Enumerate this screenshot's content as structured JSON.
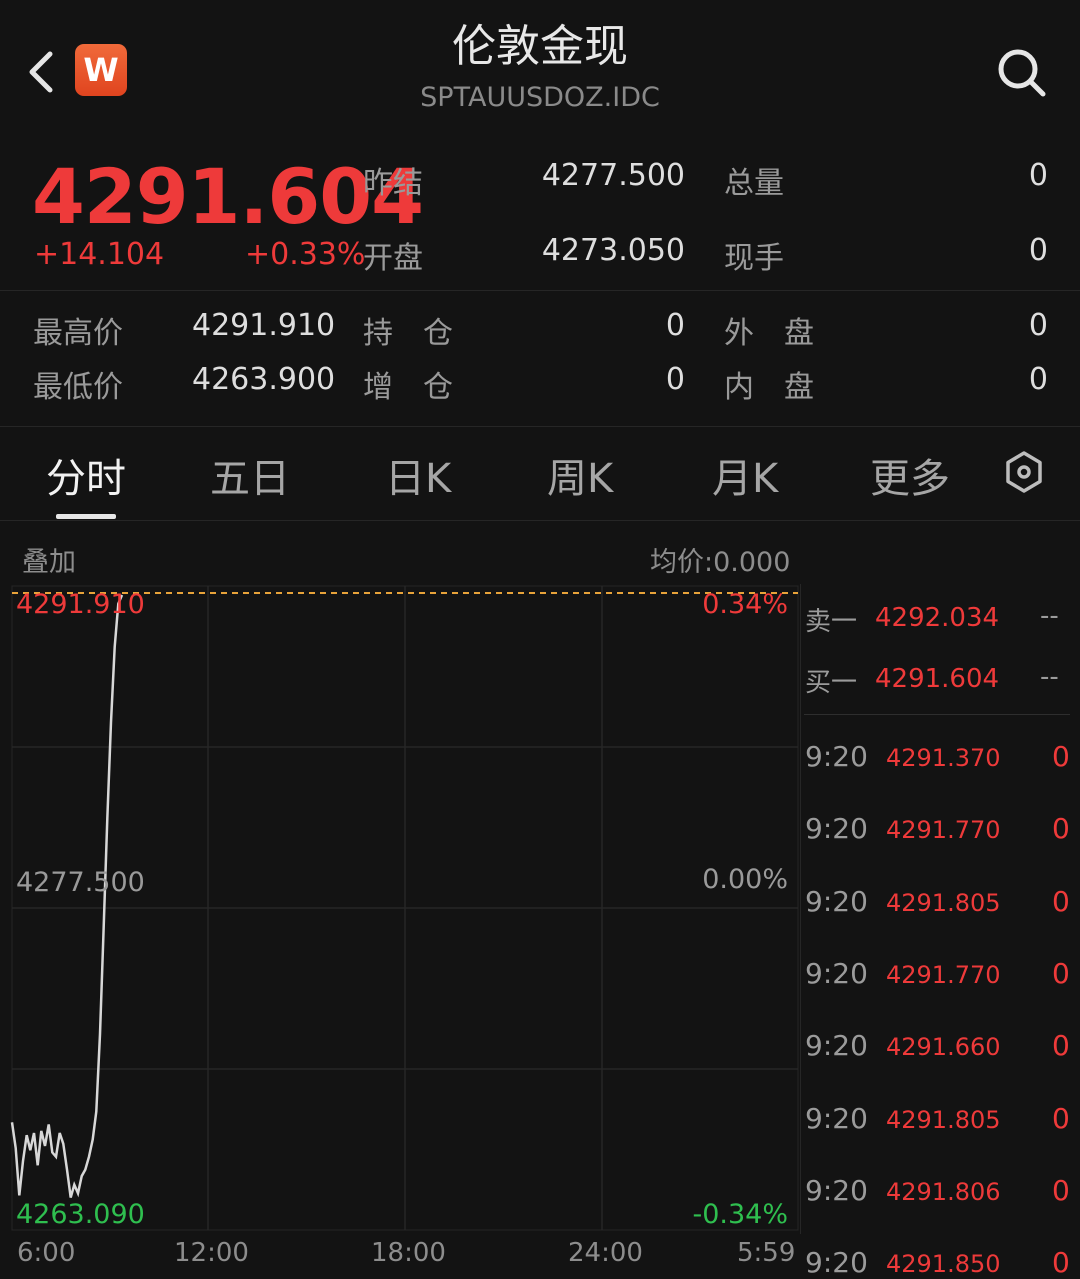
{
  "header": {
    "title": "伦敦金现",
    "subtitle": "SPTAUUSDOZ.IDC",
    "logo_letter": "W"
  },
  "quote": {
    "price": "4291.604",
    "change": "+14.104",
    "change_pct": "+0.33%",
    "fields": [
      {
        "label": "昨结",
        "value": "4277.500"
      },
      {
        "label": "开盘",
        "value": "4273.050"
      },
      {
        "label": "总量",
        "value": "0"
      },
      {
        "label": "现手",
        "value": "0"
      },
      {
        "label": "最高价",
        "value": "4291.910"
      },
      {
        "label": "最低价",
        "value": "4263.900"
      },
      {
        "label": "持　仓",
        "value": "0"
      },
      {
        "label": "增　仓",
        "value": "0"
      },
      {
        "label": "外　盘",
        "value": "0"
      },
      {
        "label": "内　盘",
        "value": "0"
      }
    ]
  },
  "tabs": [
    "分时",
    "五日",
    "日K",
    "周K",
    "月K",
    "更多"
  ],
  "chart_header": {
    "overlay": "叠加",
    "avg": "均价:0.000"
  },
  "chart_data": {
    "type": "line",
    "y_left_labels": [
      "4291.910",
      "4277.500",
      "4263.090"
    ],
    "y_right_labels": [
      "0.34%",
      "0.00%",
      "-0.34%"
    ],
    "x_labels": [
      "6:00",
      "12:00",
      "18:00",
      "24:00",
      "5:59"
    ],
    "ylim": [
      4263.09,
      4291.91
    ],
    "reference_value": 4277.5,
    "series": [
      {
        "values": [
          4267.4,
          4266.2,
          4264.0,
          4265.6,
          4266.8,
          4266.1,
          4266.9,
          4265.4,
          4267.0,
          4266.3,
          4267.3,
          4266.0,
          4265.8,
          4266.9,
          4266.4,
          4265.2,
          4263.9,
          4264.5,
          4264.1,
          4264.9,
          4265.2,
          4265.8,
          4266.6,
          4267.9,
          4271.5,
          4276.5,
          4281.5,
          4286.0,
          4289.5,
          4291.5,
          4291.91
        ]
      }
    ]
  },
  "order_book": [
    {
      "label": "卖一",
      "price": "4292.034",
      "vol": "--"
    },
    {
      "label": "买一",
      "price": "4291.604",
      "vol": "--"
    }
  ],
  "trades": [
    {
      "time": "9:20",
      "price": "4291.370",
      "vol": "0"
    },
    {
      "time": "9:20",
      "price": "4291.770",
      "vol": "0"
    },
    {
      "time": "9:20",
      "price": "4291.805",
      "vol": "0"
    },
    {
      "time": "9:20",
      "price": "4291.770",
      "vol": "0"
    },
    {
      "time": "9:20",
      "price": "4291.660",
      "vol": "0"
    },
    {
      "time": "9:20",
      "price": "4291.805",
      "vol": "0"
    },
    {
      "time": "9:20",
      "price": "4291.806",
      "vol": "0"
    },
    {
      "time": "9:20",
      "price": "4291.850",
      "vol": "0"
    }
  ],
  "colors": {
    "up": "#ee3a3a",
    "down": "#2fbf4f",
    "ref": "#e8a33a"
  }
}
